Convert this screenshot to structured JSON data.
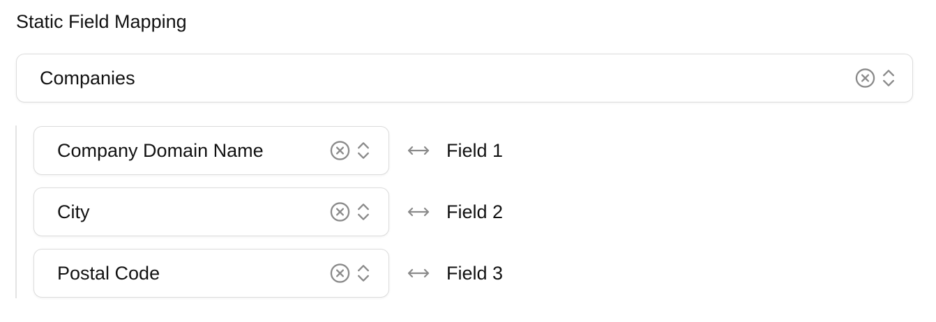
{
  "section": {
    "title": "Static Field Mapping"
  },
  "object_select": {
    "value": "Companies"
  },
  "mappings": [
    {
      "source": "Company Domain Name",
      "target": "Field 1"
    },
    {
      "source": "City",
      "target": "Field 2"
    },
    {
      "source": "Postal Code",
      "target": "Field 3"
    }
  ],
  "icons": {
    "clear": "clear-circle-x-icon",
    "selector": "chevron-up-down-icon",
    "mapping": "left-right-arrow-icon"
  },
  "colors": {
    "icon": "#8a8a8a",
    "border": "#dcdcdc",
    "text": "#111111"
  }
}
